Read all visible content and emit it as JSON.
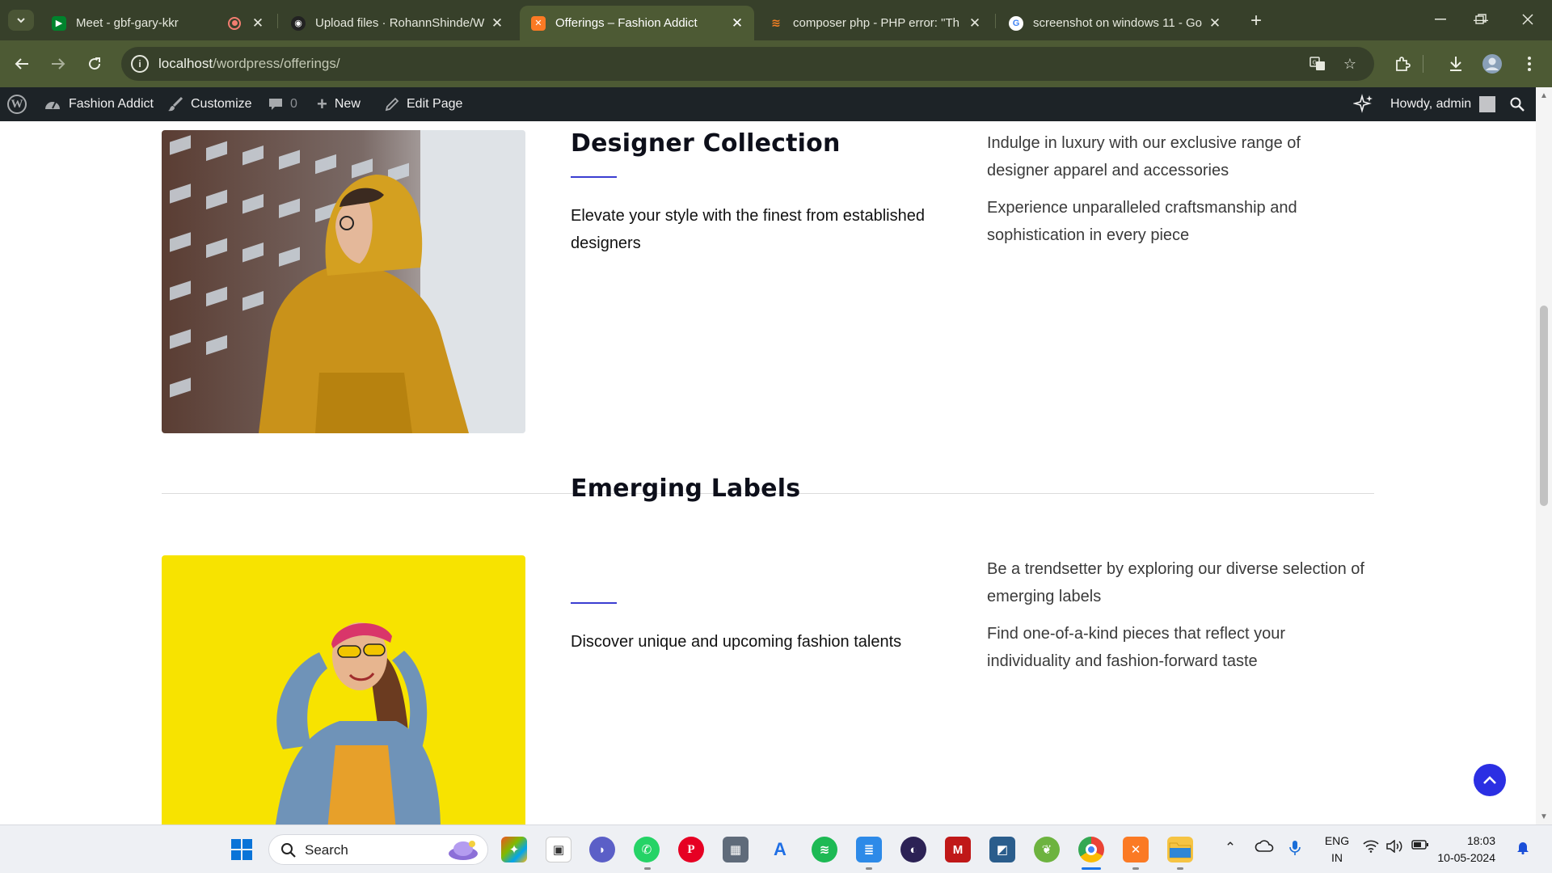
{
  "browser": {
    "tabs": [
      {
        "title": "Meet - gbf-gary-kkr",
        "active": false
      },
      {
        "title": "Upload files · RohannShinde/W",
        "active": false
      },
      {
        "title": "Offerings – Fashion Addict",
        "active": true
      },
      {
        "title": "composer php - PHP error: \"Th",
        "active": false
      },
      {
        "title": "screenshot on windows 11 - Go",
        "active": false
      }
    ],
    "url_host": "localhost",
    "url_path": "/wordpress/offerings/"
  },
  "adminbar": {
    "site_name": "Fashion Addict",
    "customize": "Customize",
    "comments_count": "0",
    "new": "New",
    "edit_page": "Edit Page",
    "howdy": "Howdy, admin"
  },
  "sections": [
    {
      "heading": "Designer Collection",
      "lead": "Elevate your style with the finest from established designers",
      "points": [
        "Indulge in luxury with our exclusive range of designer apparel and accessories",
        "Experience unparalleled craftsmanship and sophistication in every piece"
      ]
    },
    {
      "heading": "Emerging Labels",
      "lead": "Discover unique and upcoming fashion talents",
      "points": [
        "Be a trendsetter by exploring our diverse selection of emerging labels",
        "Find one-of-a-kind pieces that reflect your individuality and fashion-forward taste"
      ]
    }
  ],
  "taskbar": {
    "search_label": "Search",
    "lang_top": "ENG",
    "lang_bottom": "IN",
    "time": "18:03",
    "date": "10-05-2024"
  },
  "colors": {
    "accent": "#3b3ed1",
    "back_to_top": "#2b2fe3",
    "browser_frame": "#4d5a34",
    "admin_bar": "#1d2327"
  }
}
